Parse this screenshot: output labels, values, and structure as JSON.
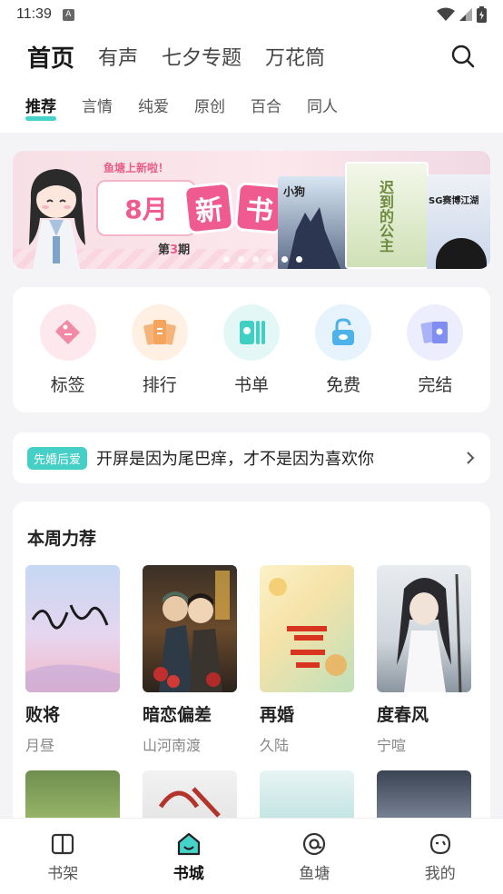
{
  "status": {
    "time": "11:39",
    "notice_icon": "A"
  },
  "top_nav": {
    "tabs": [
      {
        "label": "首页"
      },
      {
        "label": "有声"
      },
      {
        "label": "七夕专题"
      },
      {
        "label": "万花筒"
      }
    ],
    "search_icon": "search-icon"
  },
  "category_tabs": [
    {
      "label": "推荐"
    },
    {
      "label": "言情"
    },
    {
      "label": "纯爱"
    },
    {
      "label": "原创"
    },
    {
      "label": "百合"
    },
    {
      "label": "同人"
    }
  ],
  "banner": {
    "tag": "鱼塘上新啦！",
    "month": "8月",
    "new_1": "新",
    "new_2": "书",
    "issue_prefix": "第",
    "issue_num": "3",
    "issue_suffix": "期",
    "cover_a_title": "小狗",
    "cover_b_title": "迟到的公主",
    "cover_c_title": "SG赛博江湖",
    "active_dot": 4
  },
  "quick_entries": [
    {
      "label": "标签",
      "icon": "tag-icon",
      "bg": "#fde8ee",
      "fg": "#f28aa6"
    },
    {
      "label": "排行",
      "icon": "ranking-icon",
      "bg": "#fff0e3",
      "fg": "#f5a45c"
    },
    {
      "label": "书单",
      "icon": "booklist-icon",
      "bg": "#e3f8f6",
      "fg": "#3fcfc3"
    },
    {
      "label": "免费",
      "icon": "unlock-icon",
      "bg": "#e6f3fc",
      "fg": "#4eb2ea"
    },
    {
      "label": "完结",
      "icon": "cards-icon",
      "bg": "#eceefd",
      "fg": "#7f8ef0"
    }
  ],
  "notice": {
    "badge": "先婚后爱",
    "text": "开屏是因为尾巴痒，才不是因为喜欢你",
    "arrow_icon": "chevron-right-icon"
  },
  "weekly": {
    "title": "本周力荐",
    "books": [
      {
        "title": "败将",
        "author": "月昼"
      },
      {
        "title": "暗恋偏差",
        "author": "山河南渡"
      },
      {
        "title": "再婚",
        "author": "久陆"
      },
      {
        "title": "度春风",
        "author": "宁喧"
      }
    ]
  },
  "bottom_nav": [
    {
      "label": "书架",
      "icon": "bookshelf-icon"
    },
    {
      "label": "书城",
      "icon": "bookstore-icon"
    },
    {
      "label": "鱼塘",
      "icon": "fishpond-icon"
    },
    {
      "label": "我的",
      "icon": "profile-icon"
    }
  ],
  "colors": {
    "accent": "#46d3c9",
    "banner_pink": "#ef5b8f"
  }
}
